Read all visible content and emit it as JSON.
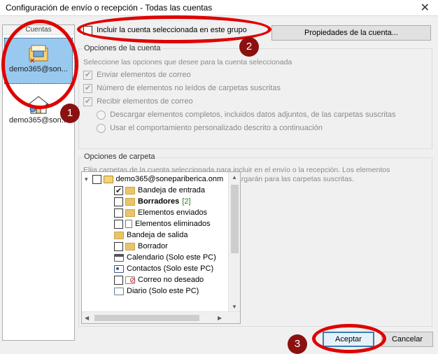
{
  "window": {
    "title": "Configuración de envío o recepción - Todas las cuentas",
    "close_glyph": "✕"
  },
  "accounts": {
    "header": "Cuentas",
    "items": [
      {
        "label": "demo365@son...",
        "icon": "exchange-account-icon",
        "selected": true
      },
      {
        "label": "demo365@son...",
        "icon": "home-account-icon",
        "selected": false
      }
    ]
  },
  "top": {
    "include_label": "Incluir la cuenta seleccionada en este grupo",
    "include_checked": false,
    "properties_button": "Propiedades de la cuenta..."
  },
  "account_options": {
    "title": "Opciones de la cuenta",
    "hint": "Seleccione las opciones que desee para la cuenta seleccionada",
    "send_label": "Enviar elementos de correo",
    "send_checked": true,
    "unread_label": "Número de elementos no leídos de carpetas suscritas",
    "unread_checked": true,
    "receive_label": "Recibir elementos de correo",
    "receive_checked": true,
    "radio_full": "Descargar elementos completos, incluidos datos adjuntos, de las carpetas suscritas",
    "radio_custom": "Usar el comportamiento personalizado descrito a continuación"
  },
  "folder_options": {
    "title": "Opciones de carpeta",
    "desc_line1": "Elija carpetas de la cuenta seleccionada para incluir en el envío o la recepción. Los elementos",
    "desc_line2": "completos que incluyan datos adjuntos se descargarán para las carpetas suscritas.",
    "tree": {
      "root": "demo365@soneparibericа.onm",
      "items": [
        {
          "label": "Bandeja de entrada",
          "checked": true,
          "icon": "inbox-folder-icon",
          "bold": false,
          "count": ""
        },
        {
          "label": "Borradores",
          "checked": false,
          "icon": "drafts-folder-icon",
          "bold": true,
          "count": "[2]"
        },
        {
          "label": "Elementos enviados",
          "checked": false,
          "icon": "sent-folder-icon",
          "bold": false,
          "count": ""
        },
        {
          "label": "Elementos eliminados",
          "checked": false,
          "icon": "deleted-folder-icon",
          "bold": false,
          "count": ""
        },
        {
          "label": "Bandeja de salida",
          "checked": null,
          "icon": "outbox-folder-icon",
          "bold": false,
          "count": ""
        },
        {
          "label": "Borrador",
          "checked": false,
          "icon": "folder-icon",
          "bold": false,
          "count": ""
        },
        {
          "label": "Calendario (Solo este PC)",
          "checked": null,
          "icon": "calendar-icon",
          "bold": false,
          "count": ""
        },
        {
          "label": "Contactos (Solo este PC)",
          "checked": null,
          "icon": "contacts-icon",
          "bold": false,
          "count": ""
        },
        {
          "label": "Correo no deseado",
          "checked": false,
          "icon": "junk-mail-icon",
          "bold": false,
          "count": ""
        },
        {
          "label": "Diario (Solo este PC)",
          "checked": null,
          "icon": "journal-icon",
          "bold": false,
          "count": ""
        }
      ]
    }
  },
  "buttons": {
    "ok": "Aceptar",
    "cancel": "Cancelar"
  },
  "annotations": {
    "badge1": "1",
    "badge2": "2",
    "badge3": "3",
    "ring_color": "#e00000",
    "badge_color": "#8b1111"
  }
}
